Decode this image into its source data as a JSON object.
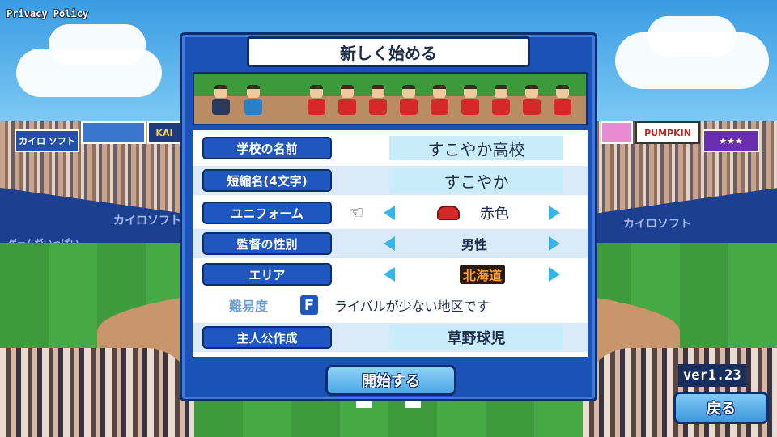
{
  "privacy_link": "Privacy Policy",
  "panel_title": "新しく始める",
  "form": {
    "school_name": {
      "label": "学校の名前",
      "value": "すこやか高校"
    },
    "short_name": {
      "label": "短縮名(4文字)",
      "value": "すこやか"
    },
    "uniform": {
      "label": "ユニフォーム",
      "value": "赤色",
      "color": "#d62828"
    },
    "manager_gender": {
      "label": "監督の性別",
      "value": "男性"
    },
    "area": {
      "label": "エリア",
      "value": "北海道"
    },
    "difficulty": {
      "label": "難易度",
      "grade": "F",
      "description": "ライバルが少ない地区です"
    },
    "protagonist": {
      "label": "主人公作成",
      "value": "草野球児"
    }
  },
  "start_button": "開始する",
  "version": "ver1.23",
  "back_button": "戻る",
  "stadium": {
    "banner_1": "カイロ ソフト",
    "banner_2": "KAI",
    "banner_3": "PUMPKIN",
    "banner_4": "★★★",
    "wall_left": "カイロソフト",
    "wall_left_2": "ゲームがいっぱい",
    "wall_right": "カイロソフト"
  }
}
